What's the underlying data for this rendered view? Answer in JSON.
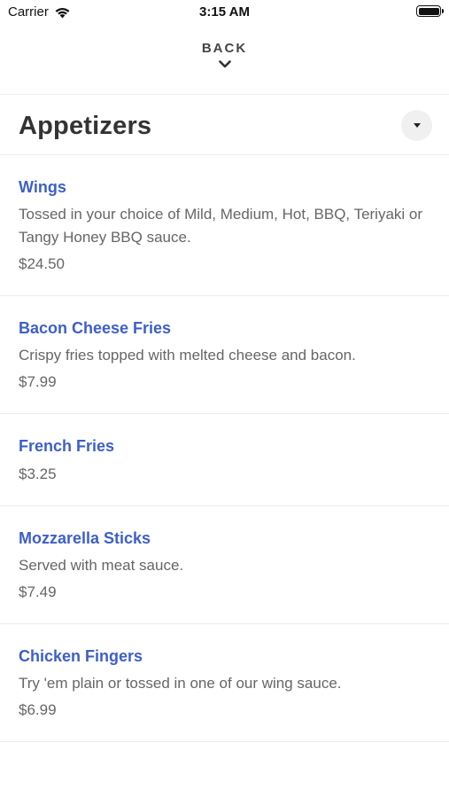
{
  "status_bar": {
    "carrier": "Carrier",
    "time": "3:15 AM"
  },
  "nav": {
    "back_label": "BACK"
  },
  "category": {
    "title": "Appetizers"
  },
  "items": [
    {
      "name": "Wings",
      "description": "Tossed in your choice of Mild, Medium, Hot, BBQ, Teriyaki or Tangy Honey BBQ sauce.",
      "price": "$24.50"
    },
    {
      "name": "Bacon Cheese Fries",
      "description": "Crispy fries topped with melted cheese and bacon.",
      "price": "$7.99"
    },
    {
      "name": "French Fries",
      "description": "",
      "price": "$3.25"
    },
    {
      "name": "Mozzarella Sticks",
      "description": "Served with meat sauce.",
      "price": "$7.49"
    },
    {
      "name": "Chicken Fingers",
      "description": "Try 'em plain or tossed in one of our wing sauce.",
      "price": "$6.99"
    }
  ],
  "colors": {
    "item_name": "#3d5fc8",
    "secondary_text": "#666666",
    "divider": "#ececec"
  }
}
